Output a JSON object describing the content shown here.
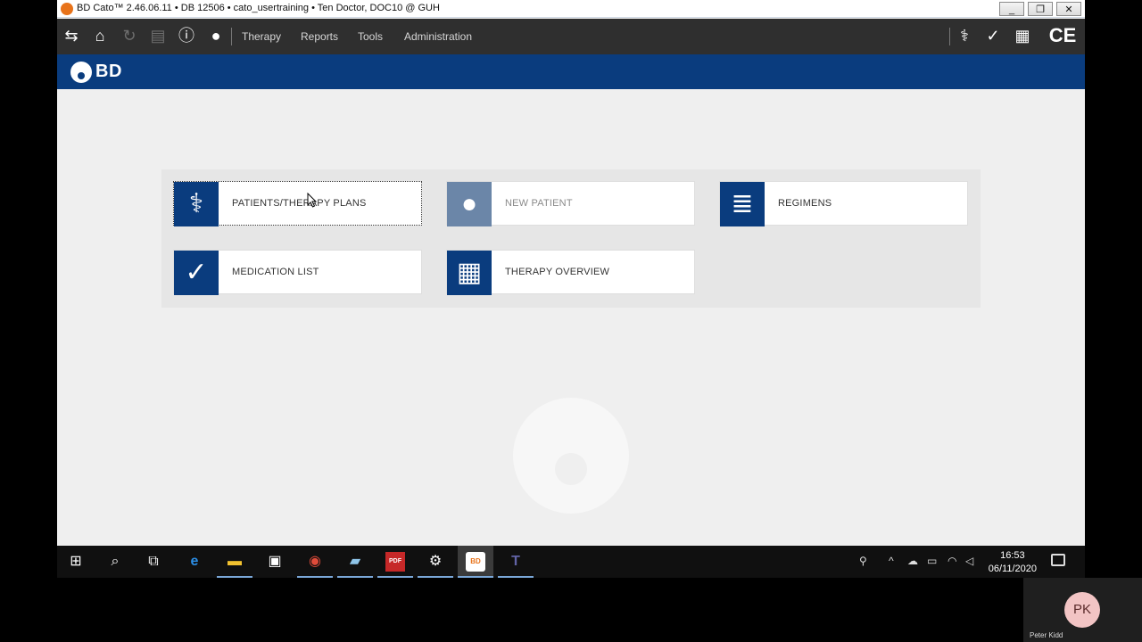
{
  "window": {
    "title": "BD Cato™ 2.46.06.11 • DB 12506 • cato_usertraining • Ten Doctor, DOC10 @ GUH",
    "minimize": "_",
    "restore": "❐",
    "close": "✕"
  },
  "toolbar": {
    "icons": [
      "swap-icon",
      "home-icon",
      "refresh-icon",
      "print-icon",
      "info-icon",
      "user-icon"
    ],
    "menu": [
      "Therapy",
      "Reports",
      "Tools",
      "Administration"
    ],
    "right_icons": [
      "caduceus-icon",
      "clipboard-check-icon",
      "calendar-icon",
      "ce-mark-icon"
    ],
    "ce_text": "CE"
  },
  "brand": {
    "name": "BD"
  },
  "tiles": [
    {
      "label": "PATIENTS/THERAPY PLANS",
      "icon": "caduceus-icon",
      "state": "selected"
    },
    {
      "label": "NEW PATIENT",
      "icon": "person-icon",
      "state": "disabled"
    },
    {
      "label": "REGIMENS",
      "icon": "scroll-icon",
      "state": "normal"
    },
    {
      "label": "MEDICATION LIST",
      "icon": "clipboard-check-icon",
      "state": "normal"
    },
    {
      "label": "THERAPY OVERVIEW",
      "icon": "calendar-icon",
      "state": "normal"
    }
  ],
  "taskbar": {
    "apps": [
      "windows-start-icon",
      "search-icon",
      "task-view-icon",
      "edge-icon",
      "file-explorer-icon",
      "store-icon",
      "chrome-icon",
      "notepad-icon",
      "pdf-icon",
      "settings-icon",
      "bd-cato-icon",
      "teams-icon"
    ],
    "pdf_badge": "PDF",
    "bd_badge": "BD",
    "time": "16:53",
    "date": "06/11/2020"
  },
  "participant": {
    "initials": "PK",
    "name": "Peter Kidd"
  },
  "colors": {
    "brand_blue": "#0a3c7e",
    "toolbar": "#2f2f2f",
    "background": "#efefef"
  }
}
